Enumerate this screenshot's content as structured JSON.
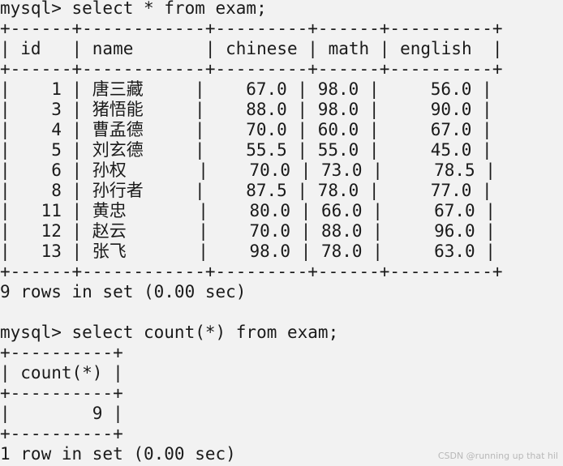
{
  "session": {
    "prompt": "mysql>",
    "query1": "select * from exam;",
    "table1": {
      "columns": [
        "id",
        "name",
        "chinese",
        "math",
        "english"
      ],
      "widths": [
        6,
        12,
        9,
        6,
        10
      ],
      "align": [
        "right",
        "left",
        "right",
        "left",
        "right"
      ],
      "rows": [
        [
          "1",
          "唐三藏",
          "67.0",
          "98.0",
          "56.0"
        ],
        [
          "3",
          "猪悟能",
          "88.0",
          "98.0",
          "90.0"
        ],
        [
          "4",
          "曹孟德",
          "70.0",
          "60.0",
          "67.0"
        ],
        [
          "5",
          "刘玄德",
          "55.5",
          "55.0",
          "45.0"
        ],
        [
          "6",
          "孙权",
          "70.0",
          "73.0",
          "78.5"
        ],
        [
          "8",
          "孙行者",
          "87.5",
          "78.0",
          "77.0"
        ],
        [
          "11",
          "黄忠",
          "80.0",
          "66.0",
          "67.0"
        ],
        [
          "12",
          "赵云",
          "70.0",
          "88.0",
          "96.0"
        ],
        [
          "13",
          "张飞",
          "98.0",
          "78.0",
          "63.0"
        ]
      ],
      "footer": "9 rows in set (0.00 sec)"
    },
    "query2": "select count(*) from exam;",
    "table2": {
      "columns": [
        "count(*)"
      ],
      "widths": [
        10
      ],
      "align": [
        "right"
      ],
      "rows": [
        [
          "9"
        ]
      ],
      "footer": "1 row in set (0.00 sec)"
    }
  },
  "watermark": "CSDN @running up that hil"
}
